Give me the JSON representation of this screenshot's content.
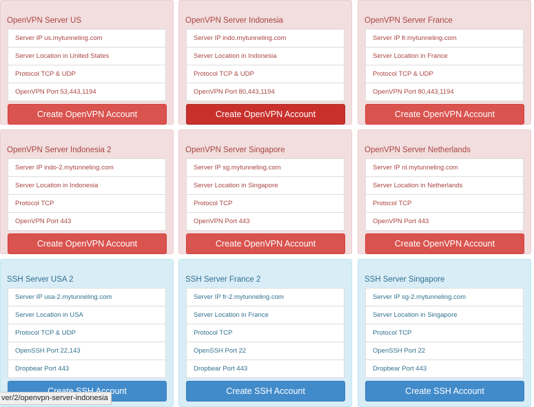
{
  "panels": [
    {
      "style": "danger",
      "title": "OpenVPN Server US",
      "items": [
        "Server IP us.mytunneling.com",
        "Server Location in United States",
        "Protocol TCP & UDP",
        "OpenVPN Port 53,443,1194"
      ],
      "button": "Create OpenVPN Account",
      "button_state": "normal"
    },
    {
      "style": "danger",
      "title": "OpenVPN Server Indonesia",
      "items": [
        "Server IP indo.mytunneling.com",
        "Server Location in Indonesia",
        "Protocol TCP & UDP",
        "OpenVPN Port 80,443,1194"
      ],
      "button": "Create OpenVPN Account",
      "button_state": "hover"
    },
    {
      "style": "danger",
      "title": "OpenVPN Server France",
      "items": [
        "Server IP fr.mytunneling.com",
        "Server Location in France",
        "Protocol TCP & UDP",
        "OpenVPN Port 80,443,1194"
      ],
      "button": "Create OpenVPN Account",
      "button_state": "normal"
    },
    {
      "style": "danger",
      "title": "OpenVPN Server Indonesia 2",
      "items": [
        "Server IP indo-2.mytunneling.com",
        "Server Location in Indonesia",
        "Protocol TCP",
        "OpenVPN Port 443"
      ],
      "button": "Create OpenVPN Account",
      "button_state": "normal"
    },
    {
      "style": "danger",
      "title": "OpenVPN Server Singapore",
      "items": [
        "Server IP sg.mytunneling.com",
        "Server Location in Singapore",
        "Protocol TCP",
        "OpenVPN Port 443"
      ],
      "button": "Create OpenVPN Account",
      "button_state": "normal"
    },
    {
      "style": "danger",
      "title": "OpenVPN Server Netherlands",
      "items": [
        "Server IP nl.mytunneling.com",
        "Server Location in Netherlands",
        "Protocol TCP",
        "OpenVPN Port 443"
      ],
      "button": "Create OpenVPN Account",
      "button_state": "normal"
    },
    {
      "style": "info",
      "title": "SSH Server USA 2",
      "items": [
        "Server IP usa-2.mytunneling.com",
        "Server Location in USA",
        "Protocol TCP & UDP",
        "OpenSSH Port 22,143",
        "Dropbear Port 443"
      ],
      "button": "Create SSH Account",
      "button_state": "normal"
    },
    {
      "style": "info",
      "title": "SSH Server France 2",
      "items": [
        "Server IP fr-2.mytunneling.com",
        "Server Location in France",
        "Protocol TCP",
        "OpenSSH Port 22",
        "Dropbear Port 443"
      ],
      "button": "Create SSH Account",
      "button_state": "normal"
    },
    {
      "style": "info",
      "title": "SSH Server Singapore",
      "items": [
        "Server IP sg-2.mytunneling.com",
        "Server Location in Singapore",
        "Protocol TCP",
        "OpenSSH Port 22",
        "Dropbear Port 443"
      ],
      "button": "Create SSH Account",
      "button_state": "normal"
    }
  ],
  "status_bar": {
    "url": "ver/2/openvpn-server-indonesia"
  },
  "colors": {
    "danger_bg": "#f2dede",
    "danger_text": "#a94442",
    "danger_button": "#d9534f",
    "info_bg": "#d9edf7",
    "info_text": "#31708f",
    "primary_button": "#428bca"
  }
}
